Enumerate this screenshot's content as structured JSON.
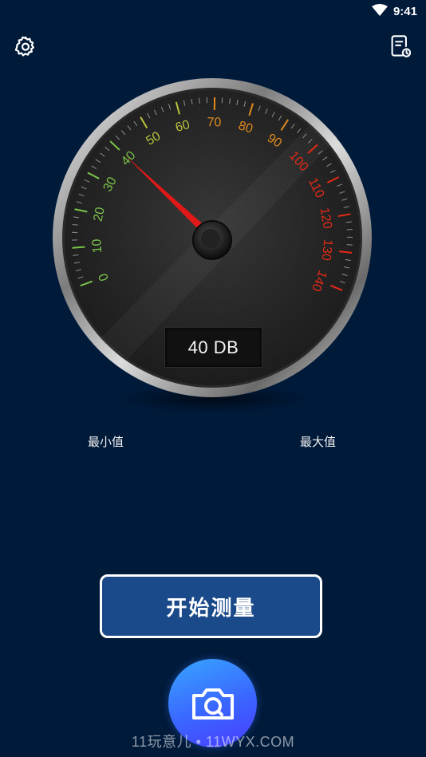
{
  "status_bar": {
    "time": "9:41",
    "wifi_icon": "wifi-icon"
  },
  "toolbar": {
    "settings_icon": "gear-icon",
    "history_icon": "history-doc-icon"
  },
  "gauge": {
    "unit": "DB",
    "value": 40,
    "display": "40 DB",
    "min": 0,
    "max": 140,
    "tick_labels": [
      "0",
      "10",
      "20",
      "30",
      "40",
      "50",
      "60",
      "70",
      "80",
      "90",
      "100",
      "110",
      "120",
      "130",
      "140"
    ],
    "tick_colors": {
      "green": "#7ac34a",
      "yellow": "#b9c03a",
      "orange": "#e18a1e",
      "red": "#e32a16"
    },
    "needle_color": "#e01818"
  },
  "labels": {
    "min": "最小值",
    "max": "最大值"
  },
  "start_button": {
    "label": "开始测量"
  },
  "camera_button": {
    "icon": "camera-icon"
  },
  "watermark": "11玩意儿 • 11WYX.COM",
  "colors": {
    "background": "#001a3a",
    "button_fill": "#1a4a8a"
  }
}
